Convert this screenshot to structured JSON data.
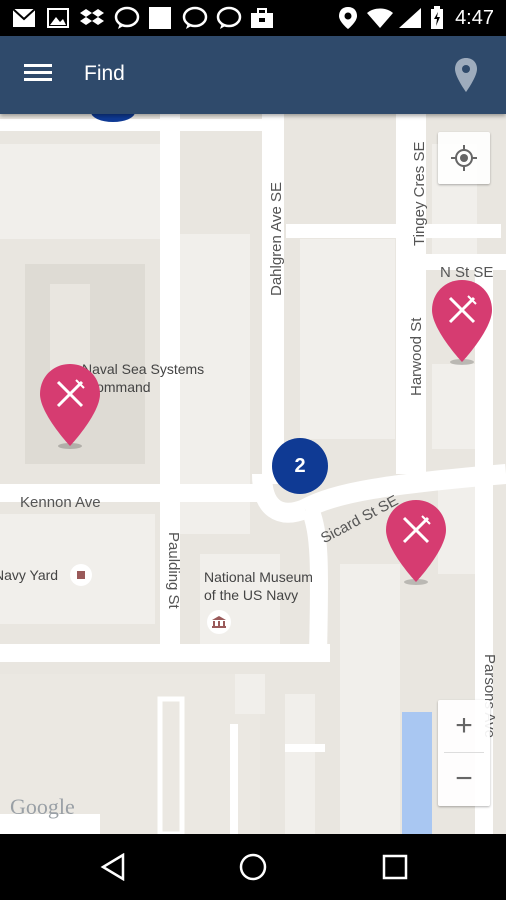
{
  "status_bar": {
    "time": "4:47",
    "left_icons": [
      "envelope-icon",
      "image-icon",
      "dropbox-icon",
      "chat-bubble-icon",
      "square-icon",
      "chat-bubble-icon",
      "chat-bubble-icon",
      "briefcase-icon"
    ],
    "right_icons": [
      "location-icon",
      "wifi-icon",
      "signal-icon",
      "battery-charging-icon"
    ]
  },
  "app_bar": {
    "title": "Find",
    "color": "#2f4a6b"
  },
  "map": {
    "streets": {
      "dahlgren": "Dahlgren Ave SE",
      "tingey": "Tingey Cres SE",
      "n_st": "N St SE",
      "harwood": "Harwood St",
      "kennon": "Kennon Ave",
      "paulding": "Paulding St",
      "sicard": "Sicard St SE",
      "parsons": "Parsons Ave"
    },
    "poi": {
      "naval_sea_line1": "Naval Sea Systems",
      "naval_sea_line2": "Command",
      "navy_yard": "Navy Yard",
      "museum_line1": "National Museum",
      "museum_line2": "of the US Navy"
    },
    "cluster_count": "2",
    "markers": [
      "restaurant-marker",
      "restaurant-marker",
      "restaurant-marker"
    ],
    "marker_color": "#d63c71",
    "cluster_color": "#0f3a94",
    "zoom_in": "+",
    "zoom_out": "−",
    "attribution": "Google"
  },
  "nav_bar": {
    "buttons": [
      "back",
      "home",
      "recents"
    ]
  }
}
